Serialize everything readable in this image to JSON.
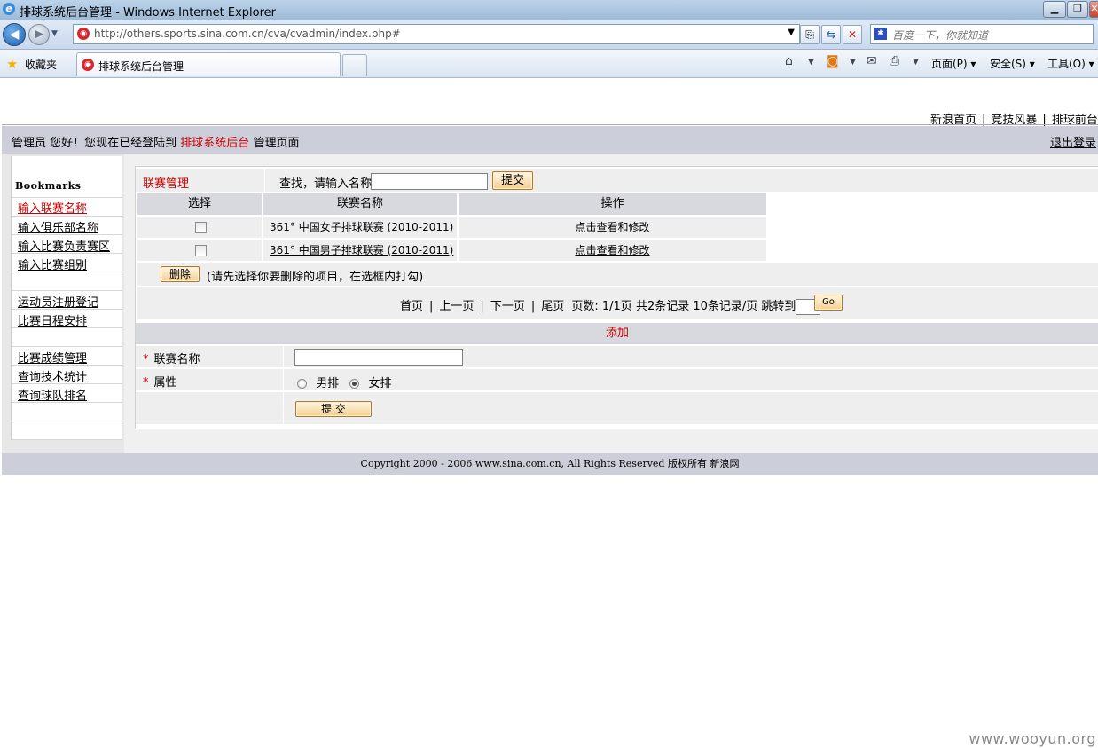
{
  "window": {
    "title": "排球系统后台管理 - Windows Internet Explorer"
  },
  "browser": {
    "url": "http://others.sports.sina.com.cn/cva/cvadmin/index.php#",
    "search_placeholder": "百度一下，你就知道",
    "favorites_label": "收藏夹",
    "tab_title": "排球系统后台管理",
    "menus": {
      "page": "页面(P)",
      "safety": "安全(S)",
      "tools": "工具(O)"
    }
  },
  "header": {
    "links": [
      "新浪首页",
      "竞技风暴",
      "排球前台"
    ],
    "admin_prefix": "管理员  您好！您现在已经登陆到",
    "admin_system": "排球系统后台",
    "admin_suffix": "管理页面",
    "logout": "退出登录"
  },
  "sidebar": {
    "heading": "Bookmarks",
    "items": [
      "输入联赛名称",
      "输入俱乐部名称",
      "输入比赛负责赛区",
      "输入比赛组别",
      "运动员注册登记",
      "比赛日程安排",
      "比赛成绩管理",
      "查询技术统计",
      "查询球队排名"
    ]
  },
  "league": {
    "title": "联赛管理",
    "search_label": "查找，请输入名称",
    "search_value": "",
    "search_button": "提交",
    "columns": [
      "选择",
      "联赛名称",
      "操作"
    ],
    "rows": [
      {
        "name": "361° 中国女子排球联赛 (2010-2011)",
        "action": "点击查看和修改"
      },
      {
        "name": "361° 中国男子排球联赛 (2010-2011)",
        "action": "点击查看和修改"
      }
    ],
    "delete_button": "删除",
    "delete_hint": "(请先选择你要删除的项目，在选框内打勾)"
  },
  "pager": {
    "first": "首页",
    "prev": "上一页",
    "next": "下一页",
    "last": "尾页",
    "info": "页数: 1/1页  共2条记录  10条记录/页  跳转到",
    "page_suffix": "页",
    "go": "Go"
  },
  "add": {
    "title": "添加",
    "name_label": "联赛名称",
    "attr_label": "属性",
    "options": [
      "男排",
      "女排"
    ],
    "selected": "女排",
    "submit": "提 交"
  },
  "footer": {
    "copyright": "Copyright 2000 - 2006 ",
    "domain": "www.sina.com.cn",
    "rights": ", All Rights Reserved 版权所有 ",
    "brand": "新浪网"
  },
  "watermark": "www.wooyun.org"
}
